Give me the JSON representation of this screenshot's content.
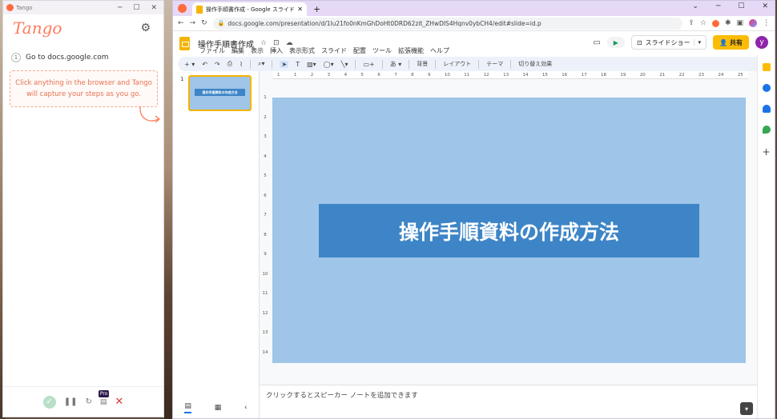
{
  "tango": {
    "window_title": "Tango",
    "logo": "Tango",
    "step_number": "1",
    "step_text": "Go to docs.google.com",
    "hint": "Click anything in the browser and Tango will capture your steps as you go.",
    "pro_badge": "Pro"
  },
  "browser": {
    "tab_title": "操作手順書作成 - Google スライド",
    "url": "docs.google.com/presentation/d/1lu21fo0nKmGhDoHt0DRD62zit_ZHwDIS4Hqnv0ybCH4/edit#slide=id.p"
  },
  "slides": {
    "doc_title": "操作手順書作成",
    "menus": [
      "ファイル",
      "編集",
      "表示",
      "挿入",
      "表示形式",
      "スライド",
      "配置",
      "ツール",
      "拡張機能",
      "ヘルプ"
    ],
    "present_label": "スライドショー",
    "share_label": "共有",
    "user_initial": "y",
    "toolbar": {
      "background": "背景",
      "layout": "レイアウト",
      "theme": "テーマ",
      "transition": "切り替え効果"
    },
    "slide_number": "1",
    "slide_title": "操作手順資料の作成方法",
    "thumb_title": "操作手順資料の作成方法",
    "speaker_notes_placeholder": "クリックするとスピーカー ノートを追加できます",
    "ruler_top": [
      "1",
      "1",
      "2",
      "3",
      "4",
      "5",
      "6",
      "7",
      "8",
      "9",
      "10",
      "11",
      "12",
      "13",
      "14",
      "15",
      "16",
      "17",
      "18",
      "19",
      "20",
      "21",
      "22",
      "23",
      "24",
      "25"
    ],
    "ruler_left": [
      "1",
      "2",
      "3",
      "4",
      "5",
      "6",
      "7",
      "8",
      "9",
      "10",
      "11",
      "12",
      "13",
      "14"
    ]
  },
  "colors": {
    "slide_bg": "#9fc5e8",
    "title_box": "#3d85c6",
    "share": "#fbbc04",
    "tango_accent": "#ff7a59"
  }
}
